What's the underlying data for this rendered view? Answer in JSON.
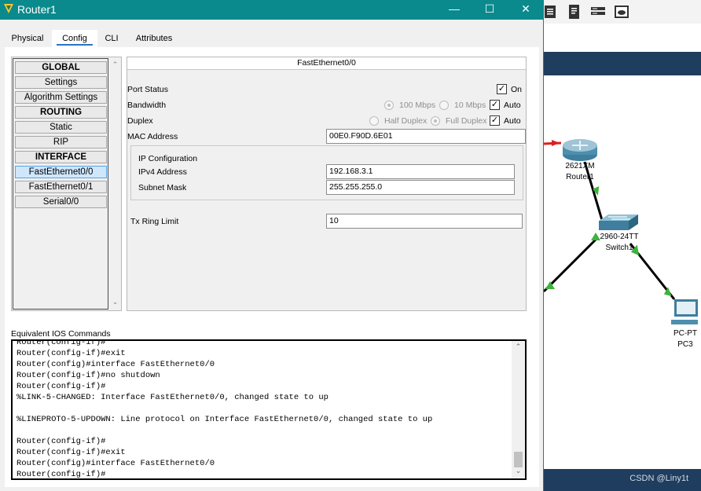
{
  "window": {
    "title": "Router1",
    "controls": {
      "minimize": "—",
      "maximize": "☐",
      "close": "✕"
    }
  },
  "tabs": [
    {
      "label": "Physical",
      "active": false
    },
    {
      "label": "Config",
      "active": true
    },
    {
      "label": "CLI",
      "active": false
    },
    {
      "label": "Attributes",
      "active": false
    }
  ],
  "nav": {
    "items": [
      {
        "label": "GLOBAL",
        "header": true
      },
      {
        "label": "Settings"
      },
      {
        "label": "Algorithm Settings"
      },
      {
        "label": "ROUTING",
        "header": true
      },
      {
        "label": "Static"
      },
      {
        "label": "RIP"
      },
      {
        "label": "INTERFACE",
        "header": true
      },
      {
        "label": "FastEthernet0/0",
        "selected": true
      },
      {
        "label": "FastEthernet0/1"
      },
      {
        "label": "Serial0/0"
      }
    ]
  },
  "interface": {
    "header": "FastEthernet0/0",
    "port_status": {
      "label": "Port Status",
      "checked": true,
      "value_label": "On"
    },
    "bandwidth": {
      "label": "Bandwidth",
      "options": [
        "100 Mbps",
        "10 Mbps"
      ],
      "selected": "100 Mbps",
      "auto_label": "Auto",
      "auto": true
    },
    "duplex": {
      "label": "Duplex",
      "options": [
        "Half Duplex",
        "Full Duplex"
      ],
      "selected": "Full Duplex",
      "auto_label": "Auto",
      "auto": true
    },
    "mac": {
      "label": "MAC Address",
      "value": "00E0.F90D.6E01"
    },
    "ip_config": {
      "title": "IP Configuration",
      "ipv4_label": "IPv4 Address",
      "ipv4_value": "192.168.3.1",
      "mask_label": "Subnet Mask",
      "mask_value": "255.255.255.0"
    },
    "tx_ring": {
      "label": "Tx Ring Limit",
      "value": "10"
    }
  },
  "ios": {
    "label": "Equivalent IOS Commands",
    "text": "Router(config-if)#\nRouter(config-if)#exit\nRouter(config)#interface FastEthernet0/0\nRouter(config-if)#no shutdown\nRouter(config-if)#\n%LINK-5-CHANGED: Interface FastEthernet0/0, changed state to up\n\n%LINEPROTO-5-UPDOWN: Line protocol on Interface FastEthernet0/0, changed state to up\n\nRouter(config-if)#\nRouter(config-if)#exit\nRouter(config)#interface FastEthernet0/0\nRouter(config-if)#"
  },
  "topology": {
    "router": {
      "model": "2621XM",
      "name": "Router1"
    },
    "switch": {
      "model": "2960-24TT",
      "name": "Switch1"
    },
    "pc": {
      "model": "PC-PT",
      "name": "PC3"
    }
  },
  "statusbar": {
    "watermark": "CSDN @Liny1t"
  },
  "colors": {
    "titlebar": "#0b8a8d",
    "banner": "#1f3d5e",
    "link_up": "#3cb33c",
    "link_down": "#d92020"
  }
}
